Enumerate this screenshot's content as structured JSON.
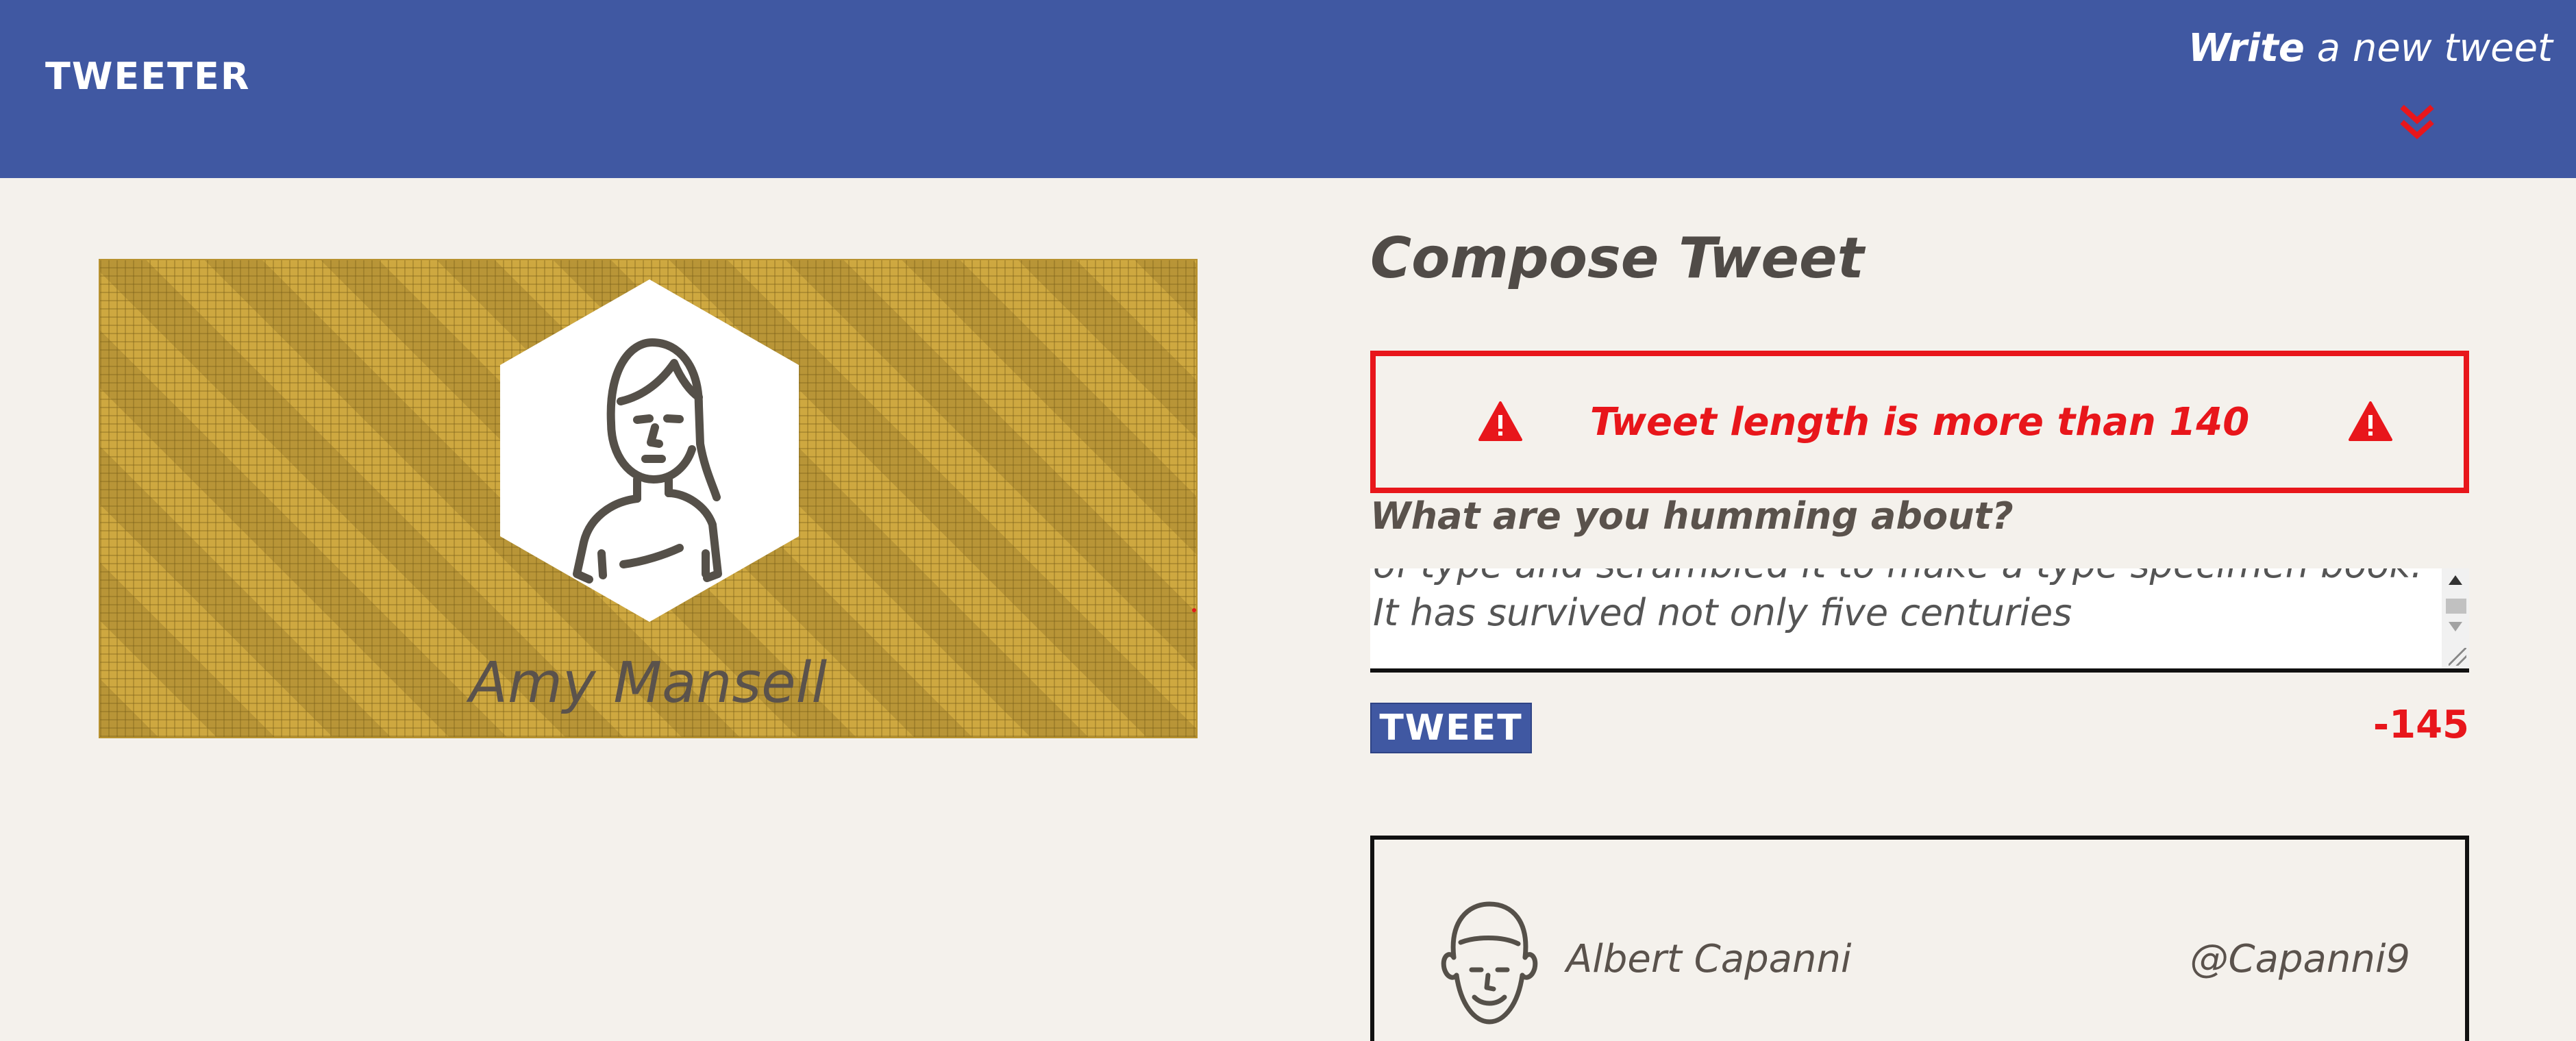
{
  "header": {
    "brand": "TWEETER",
    "nav_bold": "Write",
    "nav_rest": " a new tweet",
    "chevron_icon": "double-chevron-down-icon"
  },
  "profile": {
    "name": "Amy Mansell",
    "avatar_icon": "woman-avatar-icon"
  },
  "compose": {
    "title": "Compose Tweet",
    "alert_message": "Tweet length is more than 140",
    "alert_icon": "warning-triangle-icon",
    "prompt": "What are you humming about?",
    "textarea_value": "of type and scrambled it to make a type specimen book. It has survived not only five centuries",
    "button_label": "TWEET",
    "counter": "-145"
  },
  "tweets": [
    {
      "author": "Albert Capanni",
      "handle": "@Capanni9",
      "avatar_icon": "man-avatar-icon"
    }
  ],
  "colors": {
    "header_bg": "#4058a2",
    "page_bg": "#f4f1ec",
    "error_red": "#e8161b",
    "card_gold": "#c9a23a"
  }
}
